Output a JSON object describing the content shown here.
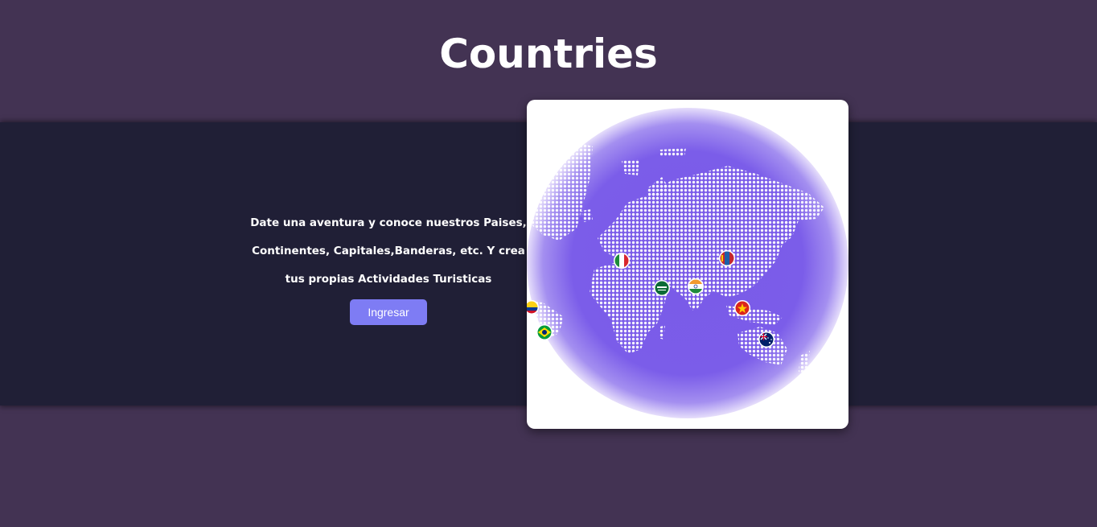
{
  "header": {
    "title": "Countries"
  },
  "hero": {
    "description": "Date una aventura y conoce nuestros Paises, Continentes, Capitales,Banderas, etc. Y crea tus propias Actividades Turisticas",
    "button_label": "Ingresar"
  },
  "globe": {
    "flags": [
      "italy",
      "saudi-arabia",
      "india",
      "mongolia",
      "vietnam",
      "australia",
      "brazil",
      "colombia"
    ]
  },
  "colors": {
    "page_background": "#433353",
    "band_background": "#201f36",
    "button": "#7e7cf4",
    "globe": "#7b5ce8"
  }
}
